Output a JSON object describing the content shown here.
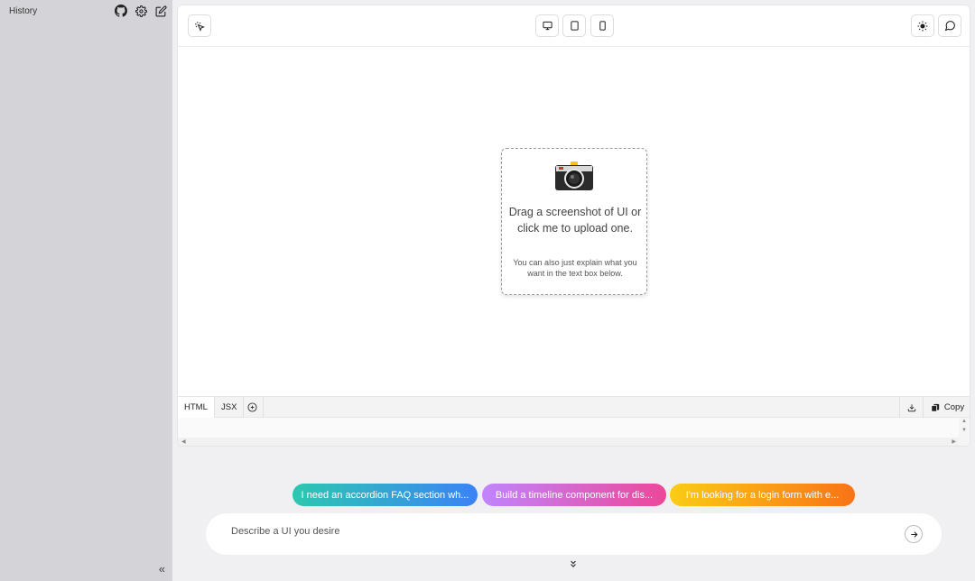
{
  "sidebar": {
    "title": "History",
    "icons": [
      "github-icon",
      "gear-icon",
      "edit-icon"
    ],
    "collapse_label": "«"
  },
  "toolbar": {
    "left_icons": [
      "cursor-select-icon"
    ],
    "device_icons": [
      "desktop-icon",
      "tablet-icon",
      "mobile-icon"
    ],
    "right_icons": [
      "sun-icon",
      "chat-icon"
    ]
  },
  "upload": {
    "main_text": "Drag a screenshot of UI or click me to upload one.",
    "sub_text": "You can also just explain what you want in the text box below.",
    "icon": "camera-icon"
  },
  "code_tabs": {
    "tabs": [
      {
        "label": "HTML"
      },
      {
        "label": "JSX"
      }
    ],
    "add_icon": "plus-circle-icon",
    "download_icon": "download-icon",
    "copy_label": "Copy",
    "copy_icon": "copy-icon"
  },
  "suggestions": [
    {
      "label": "I need an accordion FAQ section wh..."
    },
    {
      "label": "Build a timeline component for dis..."
    },
    {
      "label": "I'm looking for a login form with e..."
    }
  ],
  "prompt": {
    "placeholder": "Describe a UI you desire",
    "send_icon": "arrow-right-icon",
    "expand_icon": "chevrons-down-icon"
  }
}
